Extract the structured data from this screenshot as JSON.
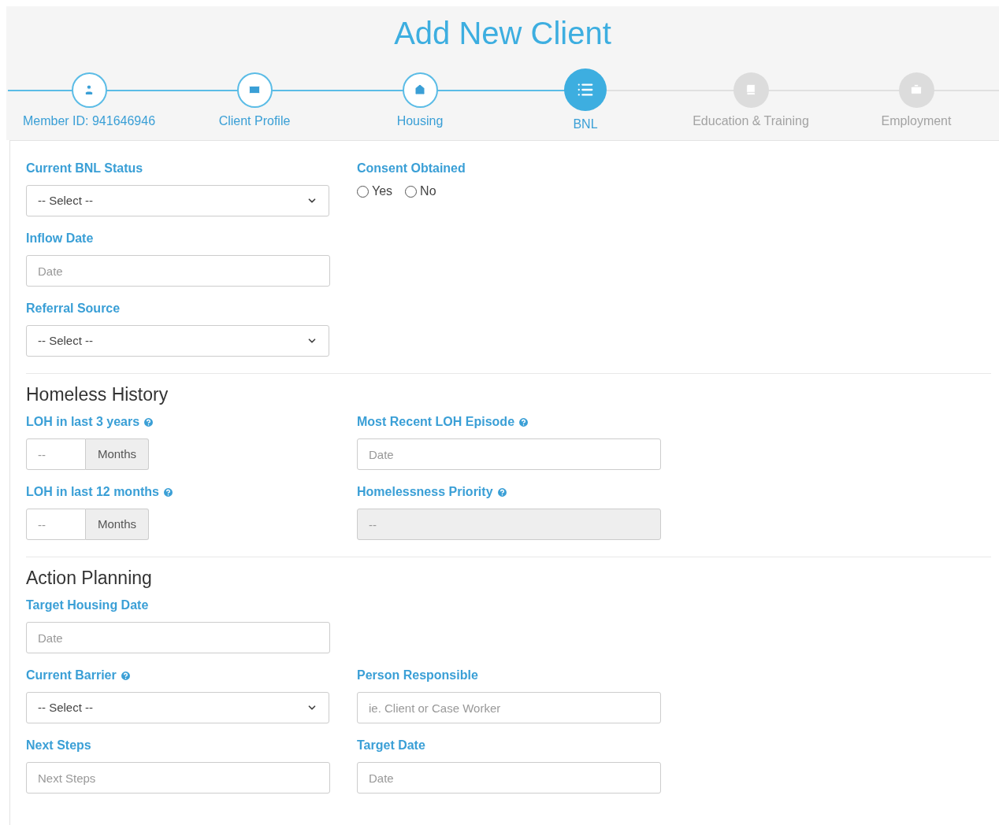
{
  "title": "Add New Client",
  "steps": [
    {
      "label": "Member ID: 941646946",
      "selected": false,
      "done": true
    },
    {
      "label": "Client Profile",
      "selected": false,
      "done": true
    },
    {
      "label": "Housing",
      "selected": false,
      "done": true
    },
    {
      "label": "BNL",
      "selected": true,
      "done": false
    },
    {
      "label": "Education & Training",
      "selected": false,
      "done": false
    },
    {
      "label": "Employment",
      "selected": false,
      "done": false
    }
  ],
  "sections": [
    {
      "rows": [
        [
          {
            "label": "Current BNL Status",
            "help": false,
            "kind": "select",
            "value": "-- Select --"
          },
          {
            "label": "Consent Obtained",
            "help": false,
            "kind": "radio",
            "options": [
              {
                "label": "Yes",
                "selected": false
              },
              {
                "label": "No",
                "selected": false
              }
            ]
          }
        ],
        [
          {
            "label": "Inflow Date",
            "help": false,
            "kind": "input",
            "placeholder": "Date",
            "disabled": false
          }
        ],
        [
          {
            "label": "Referral Source",
            "help": false,
            "kind": "select",
            "value": "-- Select --"
          }
        ]
      ]
    },
    {
      "heading": "Homeless History",
      "rows": [
        [
          {
            "label": "LOH in last 3 years",
            "help": true,
            "kind": "addon",
            "placeholder": "--",
            "unit": "Months"
          },
          {
            "label": "Most Recent LOH Episode",
            "help": true,
            "kind": "input",
            "placeholder": "Date",
            "disabled": false
          }
        ],
        [
          {
            "label": "LOH in last 12 months",
            "help": true,
            "kind": "addon",
            "placeholder": "--",
            "unit": "Months"
          },
          {
            "label": "Homelessness Priority",
            "help": true,
            "kind": "input",
            "placeholder": "--",
            "disabled": true
          }
        ]
      ]
    },
    {
      "heading": "Action Planning",
      "rows": [
        [
          {
            "label": "Target Housing Date",
            "help": false,
            "kind": "input",
            "placeholder": "Date",
            "disabled": false
          }
        ],
        [
          {
            "label": "Current Barrier",
            "help": true,
            "kind": "select",
            "value": "-- Select --"
          },
          {
            "label": "Person Responsible",
            "help": false,
            "kind": "input",
            "placeholder": "ie. Client or Case Worker",
            "disabled": false
          }
        ],
        [
          {
            "label": "Next Steps",
            "help": false,
            "kind": "input",
            "placeholder": "Next Steps",
            "disabled": false
          },
          {
            "label": "Target Date",
            "help": false,
            "kind": "input",
            "placeholder": "Date",
            "disabled": false
          }
        ]
      ]
    }
  ]
}
